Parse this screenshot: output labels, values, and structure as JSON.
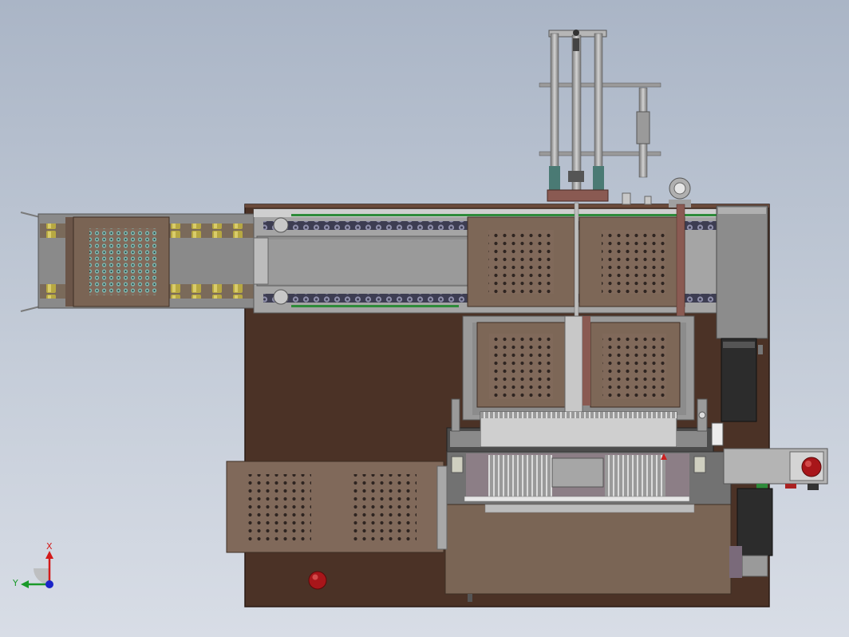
{
  "triad": {
    "x_label": "X",
    "y_label": "Y"
  },
  "colors": {
    "background_top": "#aab5c6",
    "background_bottom": "#d8dde6",
    "base_plate": "#4b3226",
    "tray": "#80695a",
    "metal": "#8e8e8e",
    "rail_green": "#2e8b3a",
    "emergency_red": "#a8161a",
    "axis_x": "#d21a1a",
    "axis_y": "#1a9a2a",
    "axis_z": "#1a24c8"
  }
}
